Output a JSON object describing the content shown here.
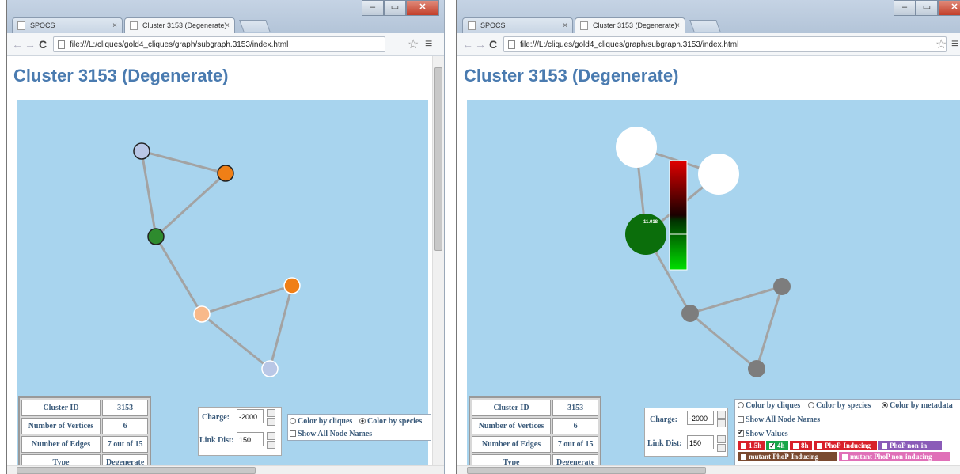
{
  "left_window": {
    "tabs": [
      {
        "label": "SPOCS",
        "active": false
      },
      {
        "label": "Cluster 3153 (Degenerate)",
        "active": true
      }
    ],
    "url": "file:///L:/cliques/gold4_cliques/graph/subgraph.3153/index.html",
    "page_title": "Cluster 3153 (Degenerate)",
    "stats": [
      {
        "label": "Cluster ID",
        "value": "3153"
      },
      {
        "label": "Number of Vertices",
        "value": "6"
      },
      {
        "label": "Number of Edges",
        "value": "7 out of 15"
      },
      {
        "label": "Type",
        "value": "Degenerate"
      }
    ],
    "charge_label": "Charge:",
    "charge_value": "-2000",
    "link_dist_label": "Link Dist:",
    "link_dist_value": "150",
    "color_by_cliques": "Color by cliques",
    "color_by_species": "Color by species",
    "color_selected": "species",
    "show_all_node_names": "Show All Node Names",
    "node_colors": [
      "#b9c7e6",
      "#f07f16",
      "#2e8b2e",
      "#f07f16",
      "#f8b98a",
      "#b9c7e6"
    ]
  },
  "right_window": {
    "tabs": [
      {
        "label": "SPOCS",
        "active": false
      },
      {
        "label": "Cluster 3153 (Degenerate)",
        "active": true
      }
    ],
    "url": "file:///L:/cliques/gold4_cliques/graph/subgraph.3153/index.html",
    "page_title": "Cluster 3153 (Degenerate)",
    "stats": [
      {
        "label": "Cluster ID",
        "value": "3153"
      },
      {
        "label": "Number of Vertices",
        "value": "6"
      },
      {
        "label": "Number of Edges",
        "value": "7 out of 15"
      },
      {
        "label": "Type",
        "value": "Degenerate"
      }
    ],
    "charge_label": "Charge:",
    "charge_value": "-2000",
    "link_dist_label": "Link Dist:",
    "link_dist_value": "150",
    "color_by_cliques": "Color by cliques",
    "color_by_species": "Color by species",
    "color_by_metadata": "Color by metadata",
    "color_selected": "metadata",
    "show_all_node_names": "Show All Node Names",
    "show_values": "Show Values",
    "show_values_checked": true,
    "node_value_label": "11.018",
    "metadata_badges": [
      {
        "label": "1.5h",
        "checked": false,
        "color": "#d8202a"
      },
      {
        "label": "4h",
        "checked": true,
        "color": "#19a64a"
      },
      {
        "label": "8h",
        "checked": false,
        "color": "#d8202a"
      },
      {
        "label": "PhoP-Inducing",
        "checked": false,
        "color": "#d8202a"
      },
      {
        "label": "PhoP non-in",
        "checked": false,
        "color": "#8a5bb8"
      },
      {
        "label": "mutant PhoP-Inducing",
        "checked": false,
        "color": "#7a4a30"
      },
      {
        "label": "mutant PhoP non-inducing",
        "checked": false,
        "color": "#e070b8"
      }
    ],
    "colors": {
      "gray_node": "#7d7d7d",
      "white_node": "#ffffff",
      "value_node": "#0b6e0b",
      "heat_high": "#e00000",
      "heat_low": "#00d000"
    }
  },
  "colors": {
    "title": "#4a7bb0",
    "graph_bg": "#a8d4ee",
    "edge": "#a3a3a3"
  }
}
